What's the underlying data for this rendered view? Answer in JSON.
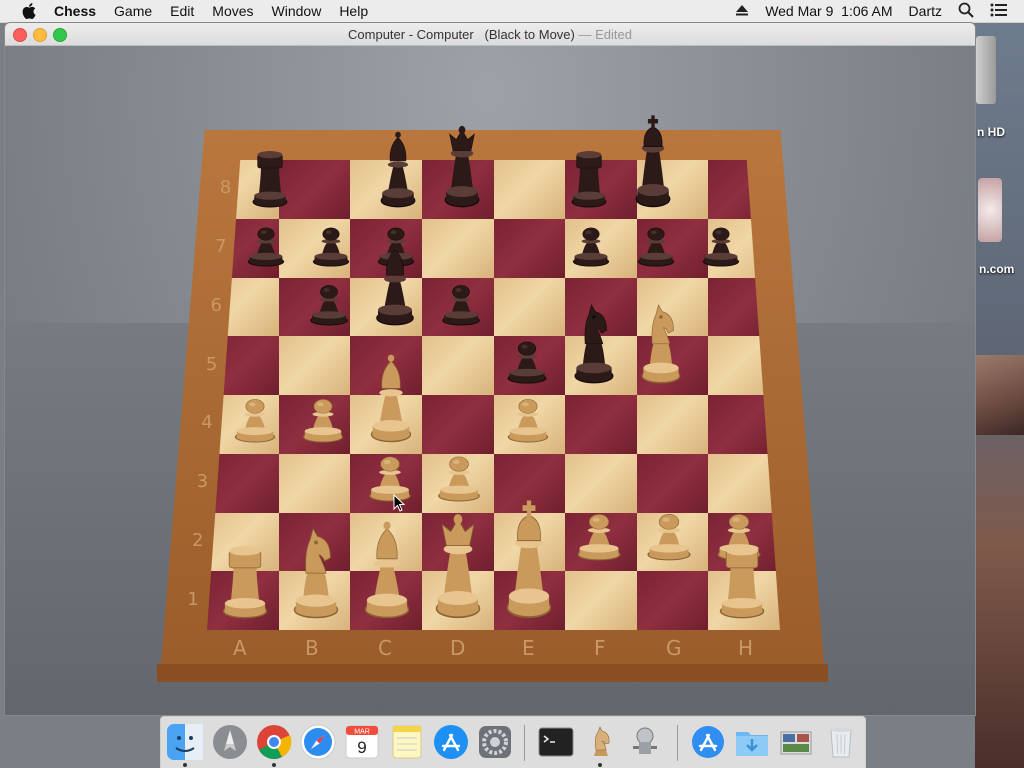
{
  "menubar": {
    "apple_icon": "apple-icon",
    "app_name": "Chess",
    "items": [
      "Game",
      "Edit",
      "Moves",
      "Window",
      "Help"
    ],
    "clock": "Wed Mar 9  1:06 AM",
    "user": "Dartz",
    "eject_icon": "eject-icon",
    "search_icon": "spotlight-icon",
    "list_icon": "notification-center-icon"
  },
  "window": {
    "title": "Computer - Computer   (Black to Move)",
    "edited": " — Edited"
  },
  "board": {
    "files": [
      "A",
      "B",
      "C",
      "D",
      "E",
      "F",
      "G",
      "H"
    ],
    "ranks": [
      "8",
      "7",
      "6",
      "5",
      "4",
      "3",
      "2",
      "1"
    ],
    "colors": {
      "dark": "#8f2f40",
      "light": "#f0d7a6",
      "frame": "#b9773e"
    },
    "pieces": [
      {
        "square": "a8",
        "color": "black",
        "type": "rook"
      },
      {
        "square": "c8",
        "color": "black",
        "type": "bishop"
      },
      {
        "square": "d8",
        "color": "black",
        "type": "queen"
      },
      {
        "square": "f8",
        "color": "black",
        "type": "rook"
      },
      {
        "square": "g8",
        "color": "black",
        "type": "king"
      },
      {
        "square": "a7",
        "color": "black",
        "type": "pawn"
      },
      {
        "square": "b7",
        "color": "black",
        "type": "pawn"
      },
      {
        "square": "c7",
        "color": "black",
        "type": "pawn"
      },
      {
        "square": "f7",
        "color": "black",
        "type": "pawn"
      },
      {
        "square": "g7",
        "color": "black",
        "type": "pawn"
      },
      {
        "square": "h7",
        "color": "black",
        "type": "pawn"
      },
      {
        "square": "b6",
        "color": "black",
        "type": "pawn"
      },
      {
        "square": "c6",
        "color": "black",
        "type": "bishop"
      },
      {
        "square": "d6",
        "color": "black",
        "type": "pawn"
      },
      {
        "square": "e5",
        "color": "black",
        "type": "pawn"
      },
      {
        "square": "f5",
        "color": "black",
        "type": "knight"
      },
      {
        "square": "g5",
        "color": "white",
        "type": "knight"
      },
      {
        "square": "a4",
        "color": "white",
        "type": "pawn"
      },
      {
        "square": "b4",
        "color": "white",
        "type": "pawn"
      },
      {
        "square": "c4",
        "color": "white",
        "type": "bishop"
      },
      {
        "square": "e4",
        "color": "white",
        "type": "pawn"
      },
      {
        "square": "c3",
        "color": "white",
        "type": "pawn"
      },
      {
        "square": "d3",
        "color": "white",
        "type": "pawn"
      },
      {
        "square": "f2",
        "color": "white",
        "type": "pawn"
      },
      {
        "square": "g2",
        "color": "white",
        "type": "pawn"
      },
      {
        "square": "h2",
        "color": "white",
        "type": "pawn"
      },
      {
        "square": "a1",
        "color": "white",
        "type": "rook"
      },
      {
        "square": "b1",
        "color": "white",
        "type": "knight"
      },
      {
        "square": "c1",
        "color": "white",
        "type": "bishop"
      },
      {
        "square": "d1",
        "color": "white",
        "type": "queen"
      },
      {
        "square": "e1",
        "color": "white",
        "type": "king"
      },
      {
        "square": "h1",
        "color": "white",
        "type": "rook"
      }
    ]
  },
  "desktop": {
    "labels": [
      "n HD",
      "n.com"
    ]
  },
  "dock": {
    "items": [
      {
        "name": "finder-icon",
        "running": true
      },
      {
        "name": "launchpad-icon",
        "running": false
      },
      {
        "name": "chrome-icon",
        "running": true
      },
      {
        "name": "safari-icon",
        "running": false
      },
      {
        "name": "calendar-icon",
        "running": false,
        "month": "MAR",
        "day": "9"
      },
      {
        "name": "notes-icon",
        "running": false
      },
      {
        "name": "app-store-icon",
        "running": false
      },
      {
        "name": "system-preferences-icon",
        "running": false
      },
      {
        "name": "terminal-icon",
        "running": false
      },
      {
        "name": "chess-app-icon",
        "running": true
      },
      {
        "name": "automator-icon",
        "running": false
      },
      {
        "name": "applications-folder-icon",
        "running": false
      },
      {
        "name": "downloads-folder-icon",
        "running": false
      },
      {
        "name": "screenshot-stack-icon",
        "running": false
      },
      {
        "name": "trash-icon",
        "running": false
      }
    ]
  }
}
